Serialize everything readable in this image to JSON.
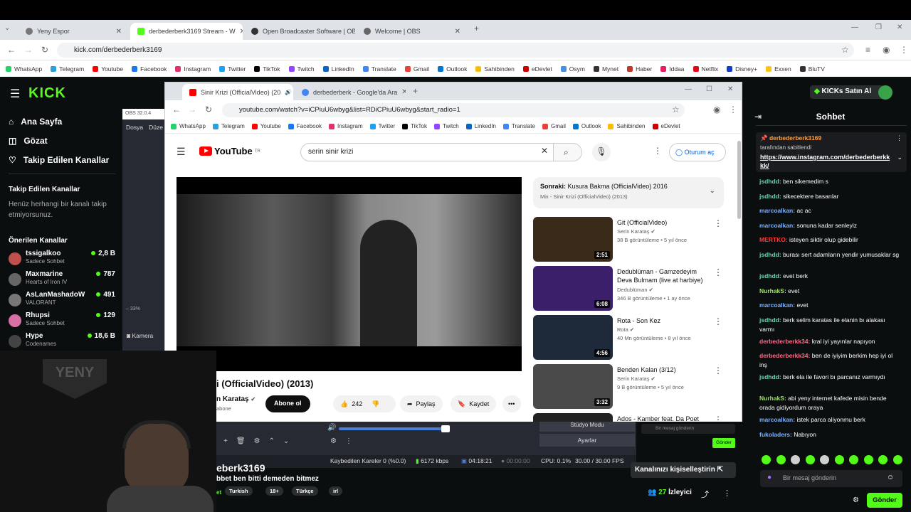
{
  "outer_browser": {
    "tabs": [
      {
        "label": "Yeny Espor",
        "active": false
      },
      {
        "label": "derbederberk3169 Stream - W",
        "active": true
      },
      {
        "label": "Open Broadcaster Software | OB",
        "active": false
      },
      {
        "label": "Welcome | OBS",
        "active": false
      }
    ],
    "url": "kick.com/derbederberk3169",
    "bookmarks": [
      "WhatsApp",
      "Telegram",
      "Youtube",
      "Facebook",
      "Instagram",
      "Twitter",
      "TikTok",
      "Twitch",
      "LinkedIn",
      "Translate",
      "Gmail",
      "Outlook",
      "Sahibinden",
      "eDevlet",
      "Osym",
      "Mynet",
      "Haber",
      "Iddaa",
      "Netflix",
      "Disney+",
      "Exxen",
      "BluTV"
    ]
  },
  "kick": {
    "logo": "KICK",
    "nav": [
      {
        "label": "Ana Sayfa",
        "icon": "home-icon"
      },
      {
        "label": "Gözat",
        "icon": "browse-icon"
      },
      {
        "label": "Takip Edilen Kanallar",
        "icon": "heart-icon"
      }
    ],
    "followed_title": "Takip Edilen Kanallar",
    "followed_empty": "Henüz herhangi bir kanalı takip etmiyorsunuz.",
    "recommended_title": "Önerilen Kanallar",
    "channels": [
      {
        "name": "tssigalkoo",
        "sub": "Sadece Sohbet",
        "viewers": "2,8 B",
        "color": "#c0504d"
      },
      {
        "name": "Maxmarine",
        "sub": "Hearts of Iron IV",
        "viewers": "787",
        "color": "#666"
      },
      {
        "name": "AsLanMashadoW",
        "sub": "VALORANT",
        "viewers": "491",
        "color": "#777"
      },
      {
        "name": "Rhupsi",
        "sub": "Sadece Sohbet",
        "viewers": "129",
        "color": "#d86fa5"
      },
      {
        "name": "Hype",
        "sub": "Codenames",
        "viewers": "18,6 B",
        "color": "#444"
      }
    ],
    "kicks_button": "KICKs Satın Al",
    "stream_title": "eberk3169",
    "stream_desc": "bbet ben bitti demeden bitmez",
    "tags": [
      "Turkish",
      "18+",
      "Türkçe",
      "irl"
    ],
    "customize": "Kanalınızı kişiselleştirin",
    "viewers_count": "27",
    "viewers_label": "İzleyici"
  },
  "inner_browser": {
    "tabs": [
      {
        "label": "Sinir Krizi (OfficialVideo) (20",
        "active": true
      },
      {
        "label": "derbederberk - Google'da Ara",
        "active": false
      }
    ],
    "url": "youtube.com/watch?v=iCPiuU6wbyg&list=RDiCPiuU6wbyg&start_radio=1",
    "bookmarks": [
      "WhatsApp",
      "Telegram",
      "Youtube",
      "Facebook",
      "Instagram",
      "Twitter",
      "TikTok",
      "Twitch",
      "LinkedIn",
      "Translate",
      "Gmail",
      "Outlook",
      "Sahibinden",
      "eDevlet"
    ]
  },
  "youtube": {
    "logo": "YouTube",
    "region": "TR",
    "search": "serin sinir krizi",
    "sign_in": "Oturum aç",
    "video_title": "i (OfficialVideo) (2013)",
    "channel": "n Karataş",
    "subs": "abone",
    "subscribe": "Abone ol",
    "likes": "242",
    "share": "Paylaş",
    "save": "Kaydet",
    "upnext_label": "Sonraki:",
    "upnext_title": "Kusura Bakma (OfficialVideo) 2016",
    "upnext_sub": "Mix - Sinir Krizi (OfficialVideo) (2013)",
    "recs": [
      {
        "title": "Git (OfficialVideo)",
        "channel": "Serin Karataş",
        "meta": "38 B görüntüleme • 5 yıl önce",
        "duration": "2:51",
        "bg": "#3a2a1a"
      },
      {
        "title": "Dedublüman - Gamzedeyim Deva Bulmam (live at harbiye)",
        "channel": "Dedublüman",
        "meta": "346 B görüntüleme • 1 ay önce",
        "duration": "6:08",
        "bg": "#3b1f6b"
      },
      {
        "title": "Rota - Son Kez",
        "channel": "Rota",
        "meta": "40 Mn görüntüleme • 8 yıl önce",
        "duration": "4:56",
        "bg": "#1e2a3a"
      },
      {
        "title": "Benden Kalan (3/12)",
        "channel": "Serin Karataş",
        "meta": "9 B görüntüleme • 5 yıl önce",
        "duration": "3:32",
        "bg": "#4a4a4a"
      },
      {
        "title": "Ados - Kamber feat. Da Poet",
        "channel": "",
        "meta": "",
        "duration": "",
        "bg": "#222"
      }
    ]
  },
  "obs": {
    "title": "OBS 32.0.4",
    "menu": [
      "Dosya",
      "Düze"
    ],
    "zoom": "33%",
    "camera": "Kamera",
    "studio_mode": "Stüdyo Modu",
    "settings": "Ayarlar",
    "dropped": "Kaybedilen Kareler 0 (%0.0)",
    "bitrate": "6172 kbps",
    "live_time": "04:18:21",
    "rec_time": "00:00:00",
    "cpu": "CPU: 0.1%",
    "fps": "30.00 / 30.00 FPS",
    "mini_chat_placeholder": "Bir mesaj gönderin",
    "mini_send": "Gönder"
  },
  "chat": {
    "title": "Sohbet",
    "pinned_user": "derbederberk3169",
    "pinned_by": "tarafından sabitlendi",
    "pinned_link": "https://www.instagram.com/derbederberkkkk/",
    "messages": [
      {
        "user": "jsdhdd",
        "text": "ben sikemedim s",
        "color": "#6fd3b0"
      },
      {
        "user": "jsdhdd",
        "text": "sikecektere basarılar",
        "color": "#6fd3b0"
      },
      {
        "user": "marcoalkan",
        "text": "ac ac",
        "color": "#7fb3ff"
      },
      {
        "user": "marcoalkan",
        "text": "sonuna kadar senleyiz",
        "color": "#7fb3ff"
      },
      {
        "user": "MERTKO",
        "text": "isteyen siktir olup gidebilir",
        "color": "#ff3b3b"
      },
      {
        "user": "jsdhdd",
        "text": "burası sert adamların yendir yumusaklar sg",
        "color": "#6fd3b0"
      },
      {
        "user": "jsdhdd",
        "text": "evet berk",
        "color": "#6fd3b0"
      },
      {
        "user": "NurhakS",
        "text": "evet",
        "color": "#9fe06b"
      },
      {
        "user": "marcoalkan",
        "text": "evet",
        "color": "#7fb3ff"
      },
      {
        "user": "jsdhdd",
        "text": "berk selim karatas ile elanin bı alakası varmı",
        "color": "#6fd3b0"
      },
      {
        "user": "derbederberkk34",
        "text": "kral iyi yayınlar napıyon",
        "color": "#ff6b8a"
      },
      {
        "user": "derbederberkk34",
        "text": "ben de iyiyim berkim hep iyi ol inş",
        "color": "#ff6b8a"
      },
      {
        "user": "jsdhdd",
        "text": "berk ela ile favori bı parcanız varmıydı",
        "color": "#6fd3b0"
      },
      {
        "user": "NurhakS",
        "text": "abi yeny internet kafede misin bende orada gidiyordum oraya",
        "color": "#9fe06b"
      },
      {
        "user": "marcoalkan",
        "text": "istek parca aliyonmu berk",
        "color": "#7fb3ff"
      },
      {
        "user": "fukoladers",
        "text": "Nabıyon",
        "color": "#7fb3ff"
      }
    ],
    "input_placeholder": "Bir mesaj gönderin",
    "send": "Gönder"
  },
  "webcam": {
    "overlay": "YENY"
  }
}
